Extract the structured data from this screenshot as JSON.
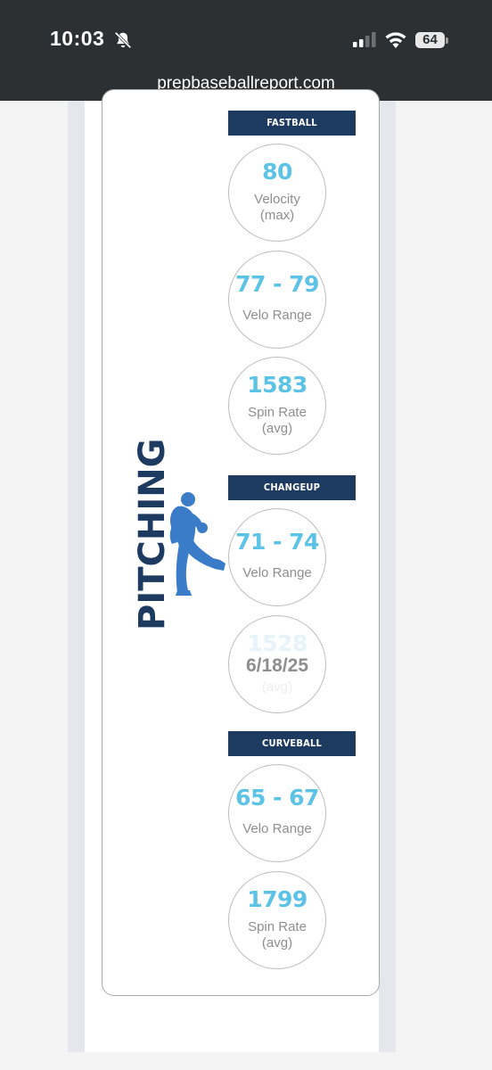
{
  "status_bar": {
    "time": "10:03",
    "battery": "64",
    "icons": [
      "bell-muted-icon",
      "signal-icon",
      "wifi-icon",
      "battery-icon"
    ]
  },
  "browser": {
    "url": "prepbaseballreport.com"
  },
  "colors": {
    "header_bg": "#1d3a60",
    "value_color": "#5cc3e6",
    "label_color": "#8e8e8e"
  },
  "pitching": {
    "side_label": "PITCHING",
    "figure_icon": "pitcher-silhouette-icon",
    "sections": [
      {
        "name": "FASTBALL",
        "stats": [
          {
            "value": "80",
            "label_line1": "Velocity",
            "label_line2": "(max)"
          },
          {
            "value": "77 - 79",
            "label_line1": "Velo Range"
          },
          {
            "value": "1583",
            "label_line1": "Spin Rate",
            "label_line2": "(avg)"
          }
        ]
      },
      {
        "name": "CHANGEUP",
        "stats": [
          {
            "value": "71 - 74",
            "label_line1": "Velo Range"
          },
          {
            "value": "1528",
            "label_line1": "(avg)",
            "overlay": "6/18/25"
          }
        ]
      },
      {
        "name": "CURVEBALL",
        "stats": [
          {
            "value": "65 - 67",
            "label_line1": "Velo Range"
          },
          {
            "value": "1799",
            "label_line1": "Spin Rate",
            "label_line2": "(avg)"
          }
        ]
      }
    ]
  }
}
